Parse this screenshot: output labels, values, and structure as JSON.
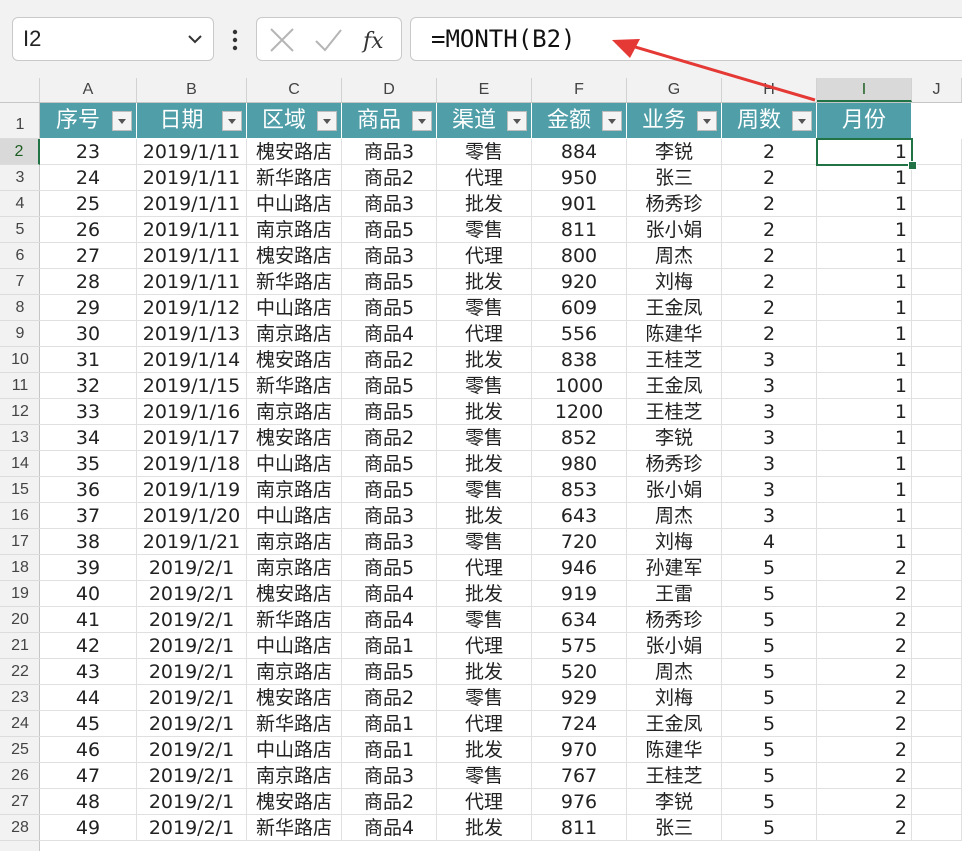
{
  "namebox": "I2",
  "formula": "=MONTH(B2)",
  "columns": [
    "A",
    "B",
    "C",
    "D",
    "E",
    "F",
    "G",
    "H",
    "I",
    "J"
  ],
  "headers": [
    "序号",
    "日期",
    "区域",
    "商品",
    "渠道",
    "金额",
    "业务",
    "周数",
    "月份"
  ],
  "rows": [
    {
      "n": "2",
      "v": [
        "23",
        "2019/1/11",
        "槐安路店",
        "商品3",
        "零售",
        "884",
        "李锐",
        "2",
        "1"
      ]
    },
    {
      "n": "3",
      "v": [
        "24",
        "2019/1/11",
        "新华路店",
        "商品2",
        "代理",
        "950",
        "张三",
        "2",
        "1"
      ]
    },
    {
      "n": "4",
      "v": [
        "25",
        "2019/1/11",
        "中山路店",
        "商品3",
        "批发",
        "901",
        "杨秀珍",
        "2",
        "1"
      ]
    },
    {
      "n": "5",
      "v": [
        "26",
        "2019/1/11",
        "南京路店",
        "商品5",
        "零售",
        "811",
        "张小娟",
        "2",
        "1"
      ]
    },
    {
      "n": "6",
      "v": [
        "27",
        "2019/1/11",
        "槐安路店",
        "商品3",
        "代理",
        "800",
        "周杰",
        "2",
        "1"
      ]
    },
    {
      "n": "7",
      "v": [
        "28",
        "2019/1/11",
        "新华路店",
        "商品5",
        "批发",
        "920",
        "刘梅",
        "2",
        "1"
      ]
    },
    {
      "n": "8",
      "v": [
        "29",
        "2019/1/12",
        "中山路店",
        "商品5",
        "零售",
        "609",
        "王金凤",
        "2",
        "1"
      ]
    },
    {
      "n": "9",
      "v": [
        "30",
        "2019/1/13",
        "南京路店",
        "商品4",
        "代理",
        "556",
        "陈建华",
        "2",
        "1"
      ]
    },
    {
      "n": "10",
      "v": [
        "31",
        "2019/1/14",
        "槐安路店",
        "商品2",
        "批发",
        "838",
        "王桂芝",
        "3",
        "1"
      ]
    },
    {
      "n": "11",
      "v": [
        "32",
        "2019/1/15",
        "新华路店",
        "商品5",
        "零售",
        "1000",
        "王金凤",
        "3",
        "1"
      ]
    },
    {
      "n": "12",
      "v": [
        "33",
        "2019/1/16",
        "南京路店",
        "商品5",
        "批发",
        "1200",
        "王桂芝",
        "3",
        "1"
      ]
    },
    {
      "n": "13",
      "v": [
        "34",
        "2019/1/17",
        "槐安路店",
        "商品2",
        "零售",
        "852",
        "李锐",
        "3",
        "1"
      ]
    },
    {
      "n": "14",
      "v": [
        "35",
        "2019/1/18",
        "中山路店",
        "商品5",
        "批发",
        "980",
        "杨秀珍",
        "3",
        "1"
      ]
    },
    {
      "n": "15",
      "v": [
        "36",
        "2019/1/19",
        "南京路店",
        "商品5",
        "零售",
        "853",
        "张小娟",
        "3",
        "1"
      ]
    },
    {
      "n": "16",
      "v": [
        "37",
        "2019/1/20",
        "中山路店",
        "商品3",
        "批发",
        "643",
        "周杰",
        "3",
        "1"
      ]
    },
    {
      "n": "17",
      "v": [
        "38",
        "2019/1/21",
        "南京路店",
        "商品3",
        "零售",
        "720",
        "刘梅",
        "4",
        "1"
      ]
    },
    {
      "n": "18",
      "v": [
        "39",
        "2019/2/1",
        "南京路店",
        "商品5",
        "代理",
        "946",
        "孙建军",
        "5",
        "2"
      ]
    },
    {
      "n": "19",
      "v": [
        "40",
        "2019/2/1",
        "槐安路店",
        "商品4",
        "批发",
        "919",
        "王雷",
        "5",
        "2"
      ]
    },
    {
      "n": "20",
      "v": [
        "41",
        "2019/2/1",
        "新华路店",
        "商品4",
        "零售",
        "634",
        "杨秀珍",
        "5",
        "2"
      ]
    },
    {
      "n": "21",
      "v": [
        "42",
        "2019/2/1",
        "中山路店",
        "商品1",
        "代理",
        "575",
        "张小娟",
        "5",
        "2"
      ]
    },
    {
      "n": "22",
      "v": [
        "43",
        "2019/2/1",
        "南京路店",
        "商品5",
        "批发",
        "520",
        "周杰",
        "5",
        "2"
      ]
    },
    {
      "n": "23",
      "v": [
        "44",
        "2019/2/1",
        "槐安路店",
        "商品2",
        "零售",
        "929",
        "刘梅",
        "5",
        "2"
      ]
    },
    {
      "n": "24",
      "v": [
        "45",
        "2019/2/1",
        "新华路店",
        "商品1",
        "代理",
        "724",
        "王金凤",
        "5",
        "2"
      ]
    },
    {
      "n": "25",
      "v": [
        "46",
        "2019/2/1",
        "中山路店",
        "商品1",
        "批发",
        "970",
        "陈建华",
        "5",
        "2"
      ]
    },
    {
      "n": "26",
      "v": [
        "47",
        "2019/2/1",
        "南京路店",
        "商品3",
        "零售",
        "767",
        "王桂芝",
        "5",
        "2"
      ]
    },
    {
      "n": "27",
      "v": [
        "48",
        "2019/2/1",
        "槐安路店",
        "商品2",
        "代理",
        "976",
        "李锐",
        "5",
        "2"
      ]
    },
    {
      "n": "28",
      "v": [
        "49",
        "2019/2/1",
        "新华路店",
        "商品4",
        "批发",
        "811",
        "张三",
        "5",
        "2"
      ]
    }
  ]
}
